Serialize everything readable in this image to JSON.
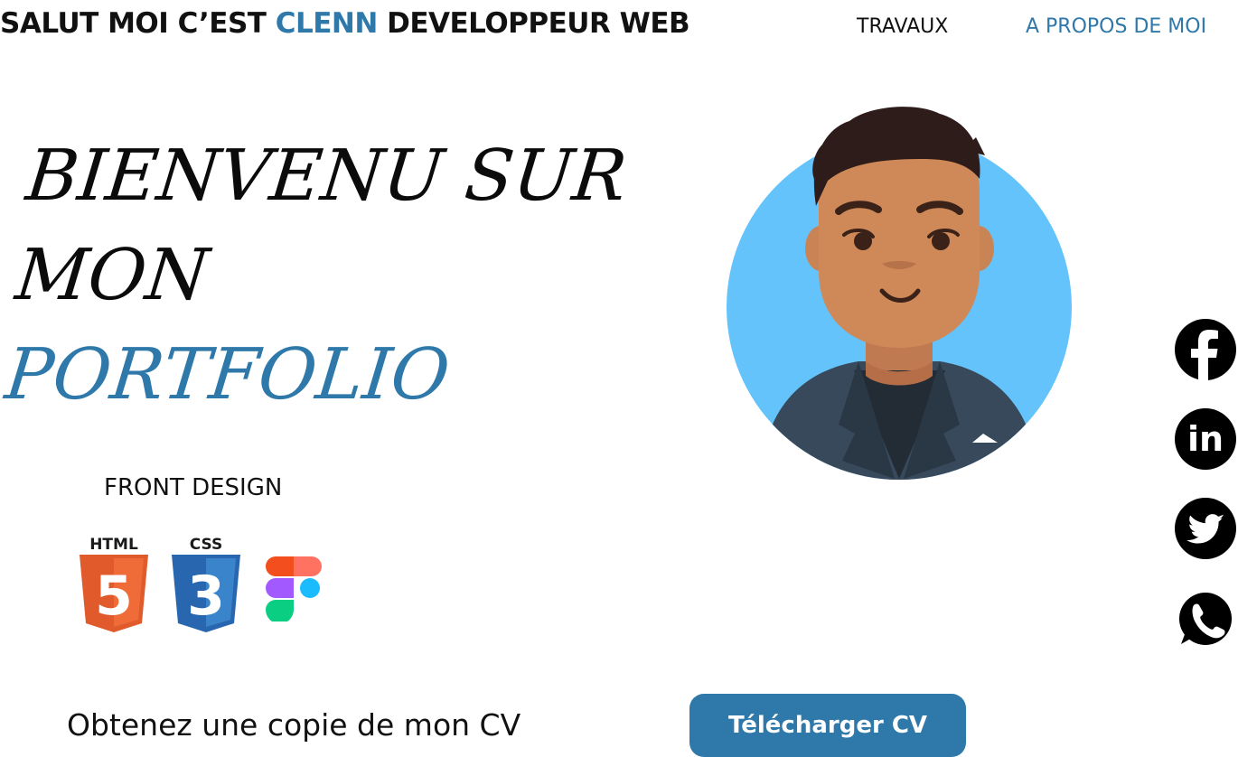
{
  "header": {
    "brand_prefix": "SALUT MOI C’EST",
    "brand_name": "CLENN",
    "brand_suffix": "DEVELOPPEUR WEB",
    "nav": {
      "travaux": "TRAVAUX",
      "a_propos": "A PROPOS DE MOI"
    }
  },
  "hero": {
    "line1": "BIENVENU SUR",
    "line2": "MON",
    "line3": "PORTFOLIO"
  },
  "skills": {
    "title": "FRONT DESIGN",
    "html_label": "HTML",
    "html_number": "5",
    "css_label": "CSS",
    "css_number": "3"
  },
  "cv": {
    "text": "Obtenez une copie de mon CV",
    "button": "Télécharger CV"
  },
  "social": {
    "linkedin_text": "in"
  },
  "colors": {
    "accent": "#2f79aa",
    "avatar_bg": "#65c3fb",
    "text": "#111111"
  },
  "icons": [
    "html5-icon",
    "css3-icon",
    "figma-icon",
    "facebook-icon",
    "linkedin-icon",
    "twitter-icon",
    "whatsapp-icon"
  ]
}
